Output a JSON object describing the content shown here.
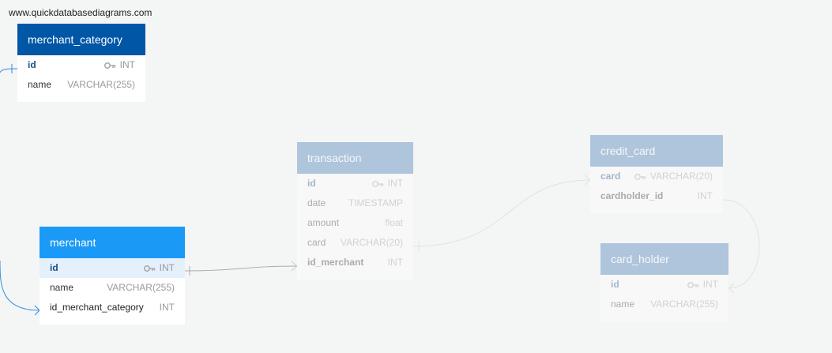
{
  "watermark": "www.quickdatabasediagrams.com",
  "colors": {
    "header_dark": "#0057a6",
    "header_bright": "#1a99f7",
    "header_faded": "#3f79b6",
    "link": "#2f8de0"
  },
  "tables": {
    "merchant_category": {
      "name": "merchant_category",
      "fields": [
        {
          "name": "id",
          "type": "INT"
        },
        {
          "name": "name",
          "type": "VARCHAR(255)"
        }
      ]
    },
    "merchant": {
      "name": "merchant",
      "fields": [
        {
          "name": "id",
          "type": "INT"
        },
        {
          "name": "name",
          "type": "VARCHAR(255)"
        },
        {
          "name": "id_merchant_category",
          "type": "INT"
        }
      ]
    },
    "transaction": {
      "name": "transaction",
      "fields": [
        {
          "name": "id",
          "type": "INT"
        },
        {
          "name": "date",
          "type": "TIMESTAMP"
        },
        {
          "name": "amount",
          "type": "float"
        },
        {
          "name": "card",
          "type": "VARCHAR(20)"
        },
        {
          "name": "id_merchant",
          "type": "INT"
        }
      ]
    },
    "credit_card": {
      "name": "credit_card",
      "fields": [
        {
          "name": "card",
          "type": "VARCHAR(20)"
        },
        {
          "name": "cardholder_id",
          "type": "INT"
        }
      ]
    },
    "card_holder": {
      "name": "card_holder",
      "fields": [
        {
          "name": "id",
          "type": "INT"
        },
        {
          "name": "name",
          "type": "VARCHAR(255)"
        }
      ]
    }
  }
}
